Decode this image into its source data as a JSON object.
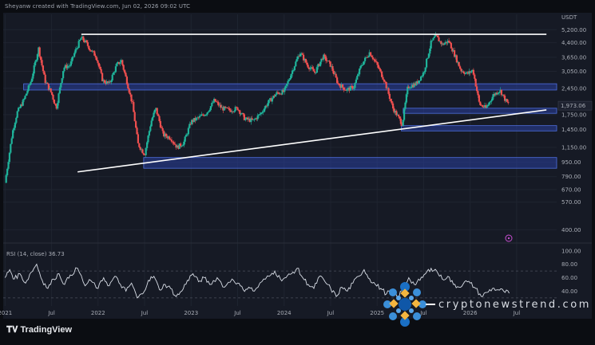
{
  "header": {
    "caption": "Sheyanw created with TradingView.com, Jun 02, 2026 09:02 UTC"
  },
  "brand": {
    "name": "TradingView"
  },
  "watermark": {
    "text": "cryptonewstrend.com"
  },
  "colors": {
    "background": "#161a25",
    "up": "#1fb39a",
    "down": "#ef4f4f",
    "zone": "#2a3f9e",
    "trendline": "#ffffff",
    "rsi": "#d8dde6",
    "price_tag": "#1e2230"
  },
  "chart_data": {
    "type": "candlestick",
    "symbol_unit": "USDT",
    "scale": "log",
    "y_ticks": [
      "5,200.00",
      "4,400.00",
      "3,650.00",
      "3,050.00",
      "2,450.00",
      "1,750.00",
      "1,450.00",
      "1,150.00",
      "950.00",
      "790.00",
      "670.00",
      "570.00",
      "400.00"
    ],
    "y_tick_values": [
      5200,
      4400,
      3650,
      3050,
      2450,
      1750,
      1450,
      1150,
      950,
      790,
      670,
      570,
      400
    ],
    "ylim": [
      370,
      5600
    ],
    "x_ticks": [
      "2021",
      "Jul",
      "2022",
      "Jul",
      "2023",
      "Jul",
      "2024",
      "Jul",
      "2025",
      "Jul",
      "2026",
      "Jul"
    ],
    "x_tick_positions": [
      2021.0,
      2021.5,
      2022.0,
      2022.5,
      2023.0,
      2023.5,
      2024.0,
      2024.5,
      2025.0,
      2025.5,
      2026.0,
      2026.5
    ],
    "xlim": [
      2020.98,
      2026.93
    ],
    "last_price": "1,973.06",
    "last_price_value": 1973,
    "price_path": [
      [
        2021.0,
        730
      ],
      [
        2021.08,
        1400
      ],
      [
        2021.13,
        1800
      ],
      [
        2021.2,
        2100
      ],
      [
        2021.28,
        2700
      ],
      [
        2021.36,
        4100
      ],
      [
        2021.43,
        2700
      ],
      [
        2021.5,
        2300
      ],
      [
        2021.55,
        1900
      ],
      [
        2021.63,
        3200
      ],
      [
        2021.7,
        3300
      ],
      [
        2021.75,
        3900
      ],
      [
        2021.82,
        4700
      ],
      [
        2021.87,
        4400
      ],
      [
        2021.92,
        4000
      ],
      [
        2021.98,
        3700
      ],
      [
        2022.05,
        2700
      ],
      [
        2022.12,
        2600
      ],
      [
        2022.2,
        3300
      ],
      [
        2022.25,
        3500
      ],
      [
        2022.3,
        2800
      ],
      [
        2022.37,
        2000
      ],
      [
        2022.43,
        1200
      ],
      [
        2022.5,
        1050
      ],
      [
        2022.57,
        1600
      ],
      [
        2022.62,
        1900
      ],
      [
        2022.7,
        1350
      ],
      [
        2022.78,
        1300
      ],
      [
        2022.85,
        1150
      ],
      [
        2022.92,
        1220
      ],
      [
        2023.0,
        1600
      ],
      [
        2023.08,
        1680
      ],
      [
        2023.17,
        1800
      ],
      [
        2023.25,
        2100
      ],
      [
        2023.33,
        1900
      ],
      [
        2023.42,
        1850
      ],
      [
        2023.5,
        1900
      ],
      [
        2023.58,
        1650
      ],
      [
        2023.67,
        1620
      ],
      [
        2023.75,
        1780
      ],
      [
        2023.83,
        2050
      ],
      [
        2023.92,
        2300
      ],
      [
        2024.0,
        2350
      ],
      [
        2024.08,
        3000
      ],
      [
        2024.17,
        3900
      ],
      [
        2024.25,
        3300
      ],
      [
        2024.33,
        3000
      ],
      [
        2024.42,
        3700
      ],
      [
        2024.5,
        3300
      ],
      [
        2024.58,
        2600
      ],
      [
        2024.67,
        2400
      ],
      [
        2024.75,
        2500
      ],
      [
        2024.83,
        3300
      ],
      [
        2024.92,
        3900
      ],
      [
        2025.0,
        3300
      ],
      [
        2025.08,
        2700
      ],
      [
        2025.17,
        1900
      ],
      [
        2025.27,
        1550
      ],
      [
        2025.33,
        2500
      ],
      [
        2025.42,
        2600
      ],
      [
        2025.5,
        3000
      ],
      [
        2025.58,
        4400
      ],
      [
        2025.63,
        4800
      ],
      [
        2025.7,
        4300
      ],
      [
        2025.77,
        4500
      ],
      [
        2025.83,
        3800
      ],
      [
        2025.9,
        3100
      ],
      [
        2025.97,
        2950
      ],
      [
        2026.03,
        3100
      ],
      [
        2026.1,
        2000
      ],
      [
        2026.17,
        1900
      ],
      [
        2026.25,
        2250
      ],
      [
        2026.32,
        2400
      ],
      [
        2026.38,
        2100
      ],
      [
        2026.42,
        1973
      ]
    ],
    "zones": [
      {
        "from": 2021.2,
        "to": 2026.93,
        "low": 2400,
        "high": 2600
      },
      {
        "from": 2025.28,
        "to": 2026.93,
        "low": 1780,
        "high": 1900
      },
      {
        "from": 2025.26,
        "to": 2026.93,
        "low": 1420,
        "high": 1520
      },
      {
        "from": 2022.49,
        "to": 2026.93,
        "low": 880,
        "high": 1010
      }
    ],
    "trendlines": [
      {
        "from": [
          2021.82,
          4900
        ],
        "to": [
          2026.82,
          4900
        ]
      },
      {
        "from": [
          2021.78,
          840
        ],
        "to": [
          2026.82,
          1860
        ]
      }
    ],
    "rsi": {
      "label": "RSI (14, close) 36.73",
      "value": 36.73,
      "y_ticks": [
        "100.00",
        "80.00",
        "60.00",
        "40.00"
      ],
      "y_tick_values": [
        100,
        80,
        60,
        40
      ],
      "ylim": [
        18,
        108
      ],
      "bands": [
        70,
        30
      ],
      "path": [
        [
          2021.0,
          60
        ],
        [
          2021.05,
          72
        ],
        [
          2021.1,
          58
        ],
        [
          2021.16,
          66
        ],
        [
          2021.22,
          52
        ],
        [
          2021.28,
          68
        ],
        [
          2021.34,
          80
        ],
        [
          2021.4,
          56
        ],
        [
          2021.46,
          44
        ],
        [
          2021.52,
          58
        ],
        [
          2021.58,
          66
        ],
        [
          2021.64,
          50
        ],
        [
          2021.7,
          64
        ],
        [
          2021.78,
          74
        ],
        [
          2021.86,
          48
        ],
        [
          2021.92,
          56
        ],
        [
          2022.0,
          44
        ],
        [
          2022.06,
          60
        ],
        [
          2022.12,
          48
        ],
        [
          2022.18,
          62
        ],
        [
          2022.24,
          50
        ],
        [
          2022.3,
          40
        ],
        [
          2022.36,
          52
        ],
        [
          2022.42,
          30
        ],
        [
          2022.48,
          36
        ],
        [
          2022.54,
          56
        ],
        [
          2022.6,
          62
        ],
        [
          2022.66,
          42
        ],
        [
          2022.72,
          50
        ],
        [
          2022.78,
          44
        ],
        [
          2022.84,
          32
        ],
        [
          2022.9,
          40
        ],
        [
          2022.96,
          56
        ],
        [
          2023.02,
          66
        ],
        [
          2023.08,
          54
        ],
        [
          2023.14,
          60
        ],
        [
          2023.2,
          50
        ],
        [
          2023.28,
          60
        ],
        [
          2023.36,
          46
        ],
        [
          2023.44,
          58
        ],
        [
          2023.5,
          52
        ],
        [
          2023.56,
          42
        ],
        [
          2023.62,
          46
        ],
        [
          2023.68,
          40
        ],
        [
          2023.76,
          54
        ],
        [
          2023.84,
          62
        ],
        [
          2023.9,
          70
        ],
        [
          2023.96,
          58
        ],
        [
          2024.02,
          60
        ],
        [
          2024.08,
          66
        ],
        [
          2024.14,
          74
        ],
        [
          2024.2,
          60
        ],
        [
          2024.26,
          50
        ],
        [
          2024.32,
          44
        ],
        [
          2024.38,
          62
        ],
        [
          2024.44,
          54
        ],
        [
          2024.5,
          44
        ],
        [
          2024.56,
          32
        ],
        [
          2024.62,
          46
        ],
        [
          2024.68,
          40
        ],
        [
          2024.74,
          52
        ],
        [
          2024.8,
          62
        ],
        [
          2024.86,
          72
        ],
        [
          2024.92,
          58
        ],
        [
          2024.98,
          50
        ],
        [
          2025.04,
          44
        ],
        [
          2025.1,
          36
        ],
        [
          2025.16,
          42
        ],
        [
          2025.22,
          30
        ],
        [
          2025.28,
          44
        ],
        [
          2025.34,
          60
        ],
        [
          2025.4,
          50
        ],
        [
          2025.46,
          56
        ],
        [
          2025.52,
          66
        ],
        [
          2025.58,
          74
        ],
        [
          2025.64,
          70
        ],
        [
          2025.7,
          58
        ],
        [
          2025.76,
          62
        ],
        [
          2025.82,
          50
        ],
        [
          2025.88,
          46
        ],
        [
          2025.94,
          54
        ],
        [
          2026.0,
          52
        ],
        [
          2026.06,
          44
        ],
        [
          2026.12,
          32
        ],
        [
          2026.18,
          38
        ],
        [
          2026.24,
          44
        ],
        [
          2026.3,
          42
        ],
        [
          2026.36,
          40
        ],
        [
          2026.42,
          37
        ]
      ]
    }
  }
}
